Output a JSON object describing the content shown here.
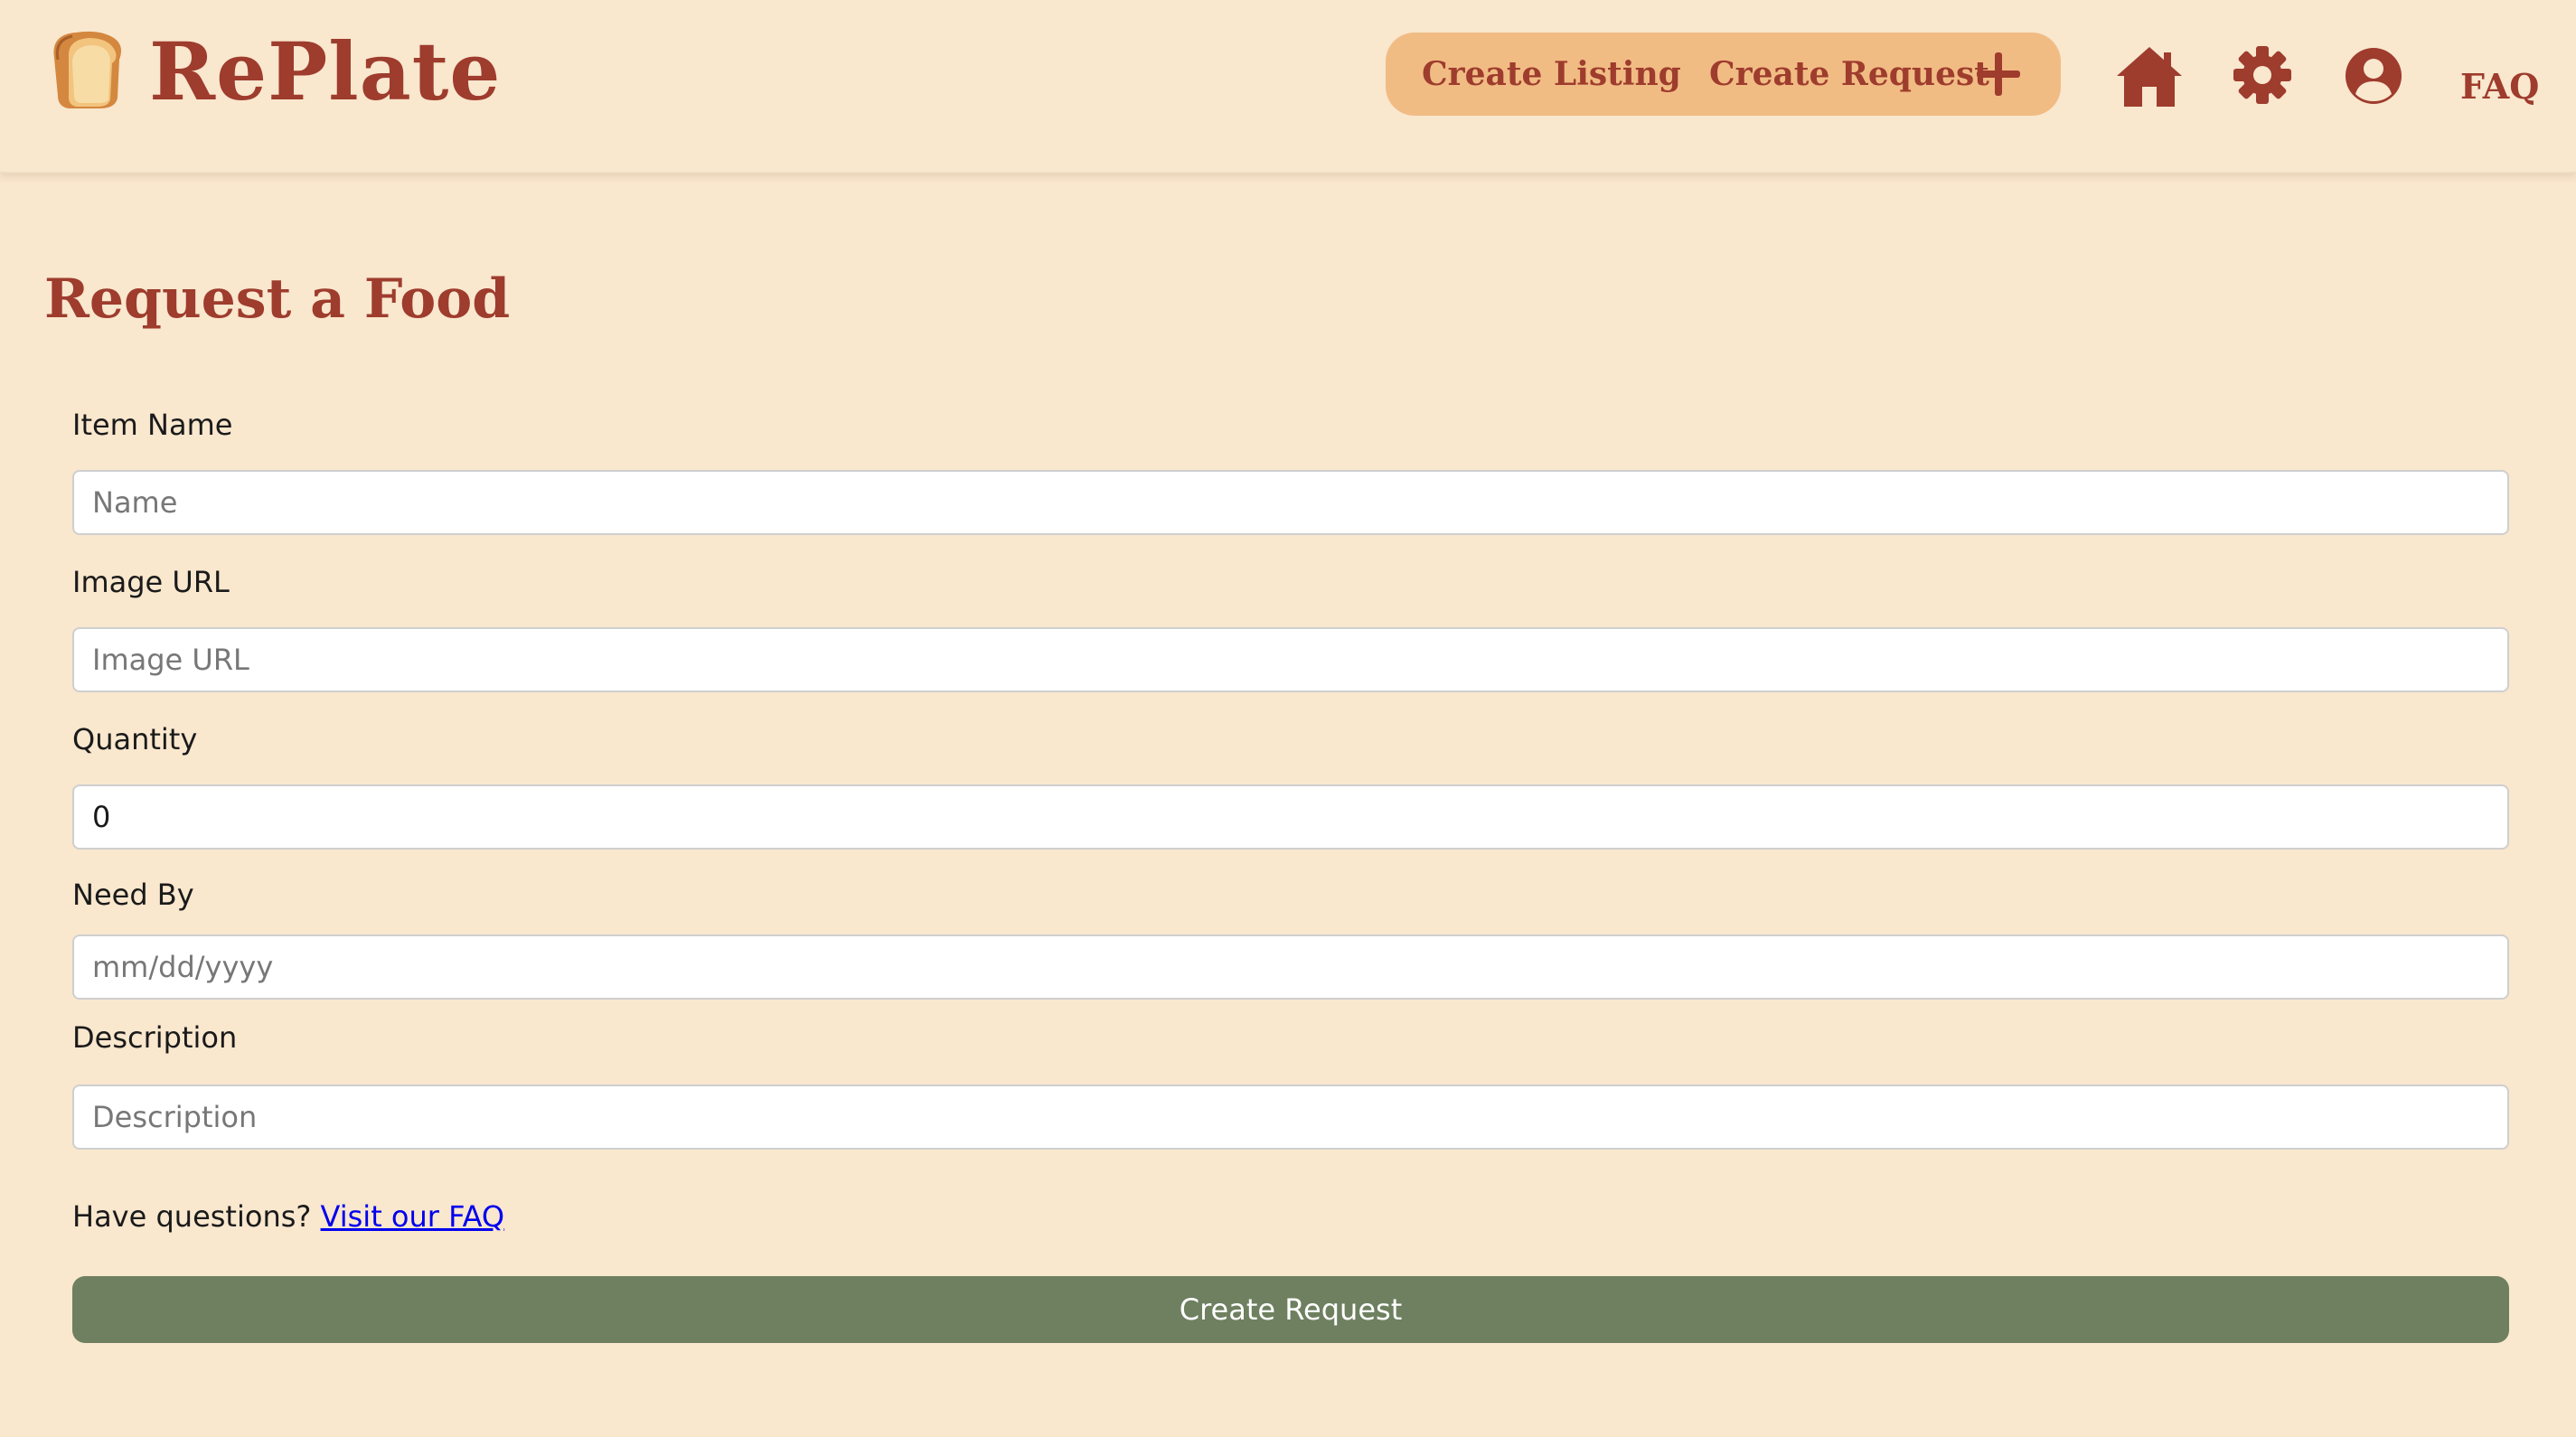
{
  "colors": {
    "background": "#f9e7ce",
    "brand": "#9e3c2d",
    "nav_pill": "#f1bc84",
    "submit_button": "#6e8060",
    "link": "#0000ee"
  },
  "header": {
    "logo_icon": "bread-icon",
    "brand_name": "RePlate",
    "nav": {
      "create_listing": "Create Listing",
      "create_request": "Create Request",
      "plus_icon": "plus-icon"
    },
    "icons": [
      "home-icon",
      "gear-icon",
      "user-circle-icon"
    ],
    "faq": "FAQ"
  },
  "form": {
    "title": "Request a Food",
    "fields": {
      "item_name": {
        "label": "Item Name",
        "placeholder": "Name",
        "value": ""
      },
      "image_url": {
        "label": "Image URL",
        "placeholder": "Image URL",
        "value": ""
      },
      "quantity": {
        "label": "Quantity",
        "placeholder": "",
        "value": "0"
      },
      "need_by": {
        "label": "Need By",
        "placeholder": "mm/dd/yyyy",
        "value": ""
      },
      "description": {
        "label": "Description",
        "placeholder": "Description",
        "value": ""
      }
    },
    "faq_prompt": "Have questions?",
    "faq_link": "Visit our FAQ",
    "submit_label": "Create Request"
  }
}
